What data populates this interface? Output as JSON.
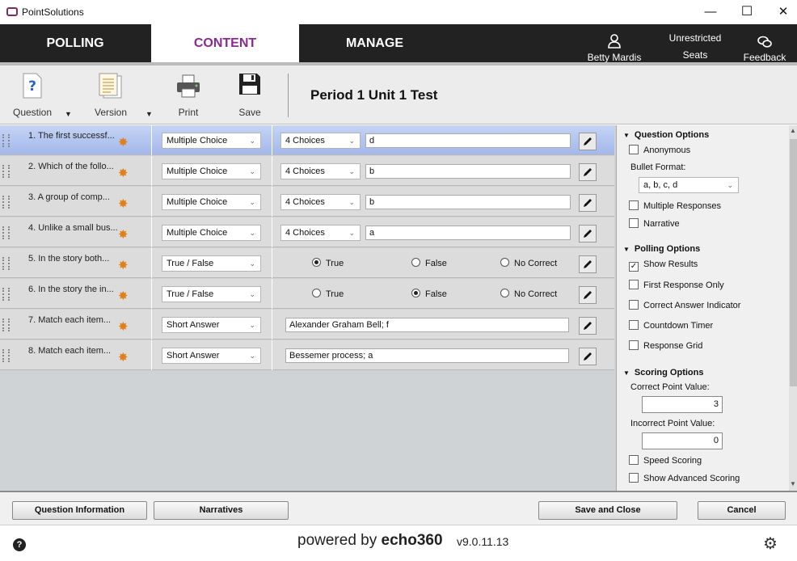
{
  "window": {
    "title": "PointSolutions",
    "min": "—",
    "max": "☐",
    "close": "✕"
  },
  "nav": {
    "tabs": [
      {
        "label": "POLLING"
      },
      {
        "label": "CONTENT"
      },
      {
        "label": "MANAGE"
      }
    ],
    "active_tab": "CONTENT",
    "user": "Betty Mardis",
    "seats_line1": "Unrestricted",
    "seats_line2": "Seats",
    "feedback": "Feedback"
  },
  "toolbar": {
    "question": "Question",
    "version": "Version",
    "print": "Print",
    "save": "Save",
    "test_title": "Period 1 Unit 1 Test"
  },
  "questions": [
    {
      "text": "1. The first successf...",
      "type": "Multiple Choice",
      "choices": "4 Choices",
      "answer": "d"
    },
    {
      "text": "2. Which of the follo...",
      "type": "Multiple Choice",
      "choices": "4 Choices",
      "answer": "b"
    },
    {
      "text": "3. A group of comp...",
      "type": "Multiple Choice",
      "choices": "4 Choices",
      "answer": "b"
    },
    {
      "text": "4. Unlike a small bus...",
      "type": "Multiple Choice",
      "choices": "4 Choices",
      "answer": "a"
    },
    {
      "text": "5. In the story both...",
      "type": "True / False",
      "true": "True",
      "false": "False",
      "nocorrect": "No Correct",
      "selected": "True"
    },
    {
      "text": "6. In the story the in...",
      "type": "True / False",
      "true": "True",
      "false": "False",
      "nocorrect": "No Correct",
      "selected": "False"
    },
    {
      "text": "7. Match each item...",
      "type": "Short Answer",
      "answer": "Alexander Graham Bell; f"
    },
    {
      "text": "8. Match each item...",
      "type": "Short Answer",
      "answer": "Bessemer process; a"
    }
  ],
  "options": {
    "question_options": "Question Options",
    "anonymous": "Anonymous",
    "bullet_format_label": "Bullet Format:",
    "bullet_format_value": "a, b, c, d",
    "multiple_responses": "Multiple Responses",
    "narrative": "Narrative",
    "polling_options": "Polling Options",
    "show_results": "Show Results",
    "first_response_only": "First Response Only",
    "correct_answer_indicator": "Correct Answer Indicator",
    "countdown_timer": "Countdown Timer",
    "response_grid": "Response Grid",
    "scoring_options": "Scoring Options",
    "correct_point_label": "Correct Point Value:",
    "correct_point_value": "3",
    "incorrect_point_label": "Incorrect Point Value:",
    "incorrect_point_value": "0",
    "speed_scoring": "Speed Scoring",
    "show_advanced_scoring": "Show Advanced Scoring",
    "checked": "✓"
  },
  "buttons": {
    "question_information": "Question Information",
    "narratives": "Narratives",
    "save_and_close": "Save and Close",
    "cancel": "Cancel"
  },
  "footer": {
    "help": "?",
    "powered_by": "powered by",
    "echo": "echo360",
    "version": "v9.0.11.13"
  }
}
